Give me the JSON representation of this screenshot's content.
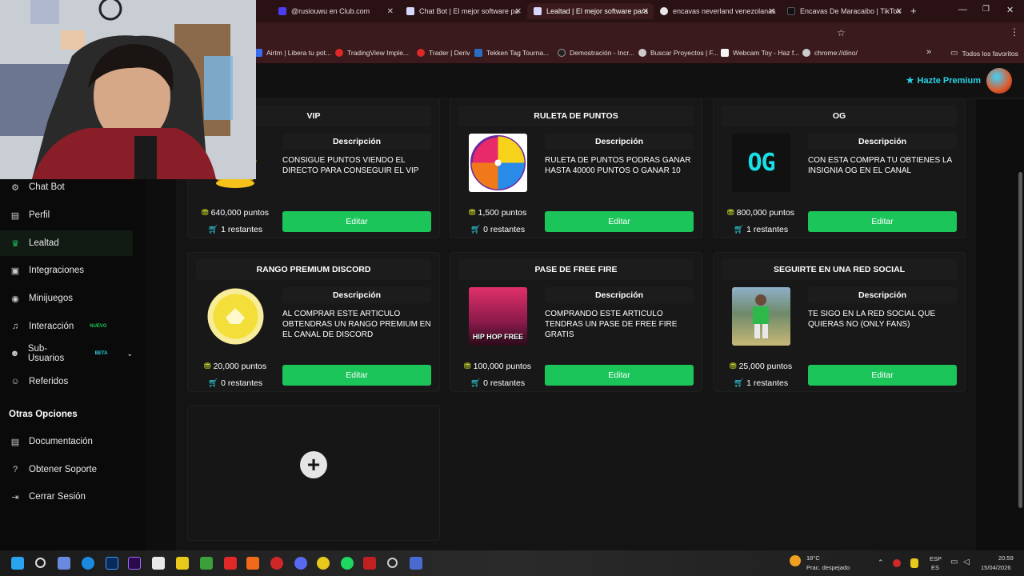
{
  "browser": {
    "tabs": [
      {
        "label": "@rusiouwu en Club.com",
        "color": "#4b3df0"
      },
      {
        "label": "Chat Bot | El mejor software pa",
        "color": "#d8d8ff"
      },
      {
        "label": "Lealtad | El mejor software para",
        "color": "#d8d8ff",
        "active": true
      },
      {
        "label": "encavas neverland venezolanas",
        "color": "#e8e8e8"
      },
      {
        "label": "Encavas De Maracaibo | TikTok",
        "color": "#111111"
      }
    ],
    "new_tab": "+",
    "bookmarks": [
      "Airtm | Libera tu pot...",
      "TradingView Imple...",
      "Trader | Deriv",
      "Tekken Tag Tourna...",
      "Demostración - Incr...",
      "Buscar Proyectos | F...",
      "Webcam Toy - Haz f...",
      "chrome://dino/"
    ],
    "bookmarks_more": "»",
    "all_bookmarks": "Todos los favoritos"
  },
  "header": {
    "premium_label": "Hazte Premium"
  },
  "sidebar": {
    "items": [
      {
        "label": "Chat Bot",
        "icon": "robot-icon"
      },
      {
        "label": "Perfil",
        "icon": "id-card-icon"
      },
      {
        "label": "Lealtad",
        "icon": "trophy-icon",
        "active": true
      },
      {
        "label": "Integraciones",
        "icon": "plug-icon"
      },
      {
        "label": "Minijuegos",
        "icon": "gamepad-icon"
      },
      {
        "label": "Interacción",
        "icon": "music-icon",
        "badge": "NUEVO",
        "badge_color": "#1cc55a"
      },
      {
        "label": "Sub-Usuarios",
        "icon": "users-icon",
        "badge": "BETA",
        "badge_color": "#29d3e6"
      },
      {
        "label": "Referidos",
        "icon": "user-group-icon"
      }
    ],
    "section_title": "Otras Opciones",
    "other": [
      {
        "label": "Documentación",
        "icon": "document-icon"
      },
      {
        "label": "Obtener Soporte",
        "icon": "help-icon"
      },
      {
        "label": "Cerrar Sesión",
        "icon": "logout-icon"
      }
    ]
  },
  "rewards": [
    {
      "title": "VIP",
      "desc_header": "Descripción",
      "description": "CONSIGUE PUNTOS VIENDO EL DIRECTO PARA CONSEGUIR EL VIP",
      "points": "640,000 puntos",
      "remaining": "1 restantes",
      "button": "Editar",
      "image": "crown-image"
    },
    {
      "title": "RULETA DE PUNTOS",
      "desc_header": "Descripción",
      "description": "RULETA DE PUNTOS PODRAS GANAR HASTA 40000 PUNTOS O GANAR 10",
      "points": "1,500 puntos",
      "remaining": "0 restantes",
      "button": "Editar",
      "image": "wheel-image"
    },
    {
      "title": "OG",
      "desc_header": "Descripción",
      "description": "CON ESTA COMPRA TU OBTIENES LA INSIGNIA OG EN EL CANAL",
      "points": "800,000 puntos",
      "remaining": "1 restantes",
      "button": "Editar",
      "image": "og-image",
      "image_text": "OG"
    },
    {
      "title": "RANGO PREMIUM DISCORD",
      "desc_header": "Descripción",
      "description": "AL COMPRAR ESTE ARTICULO OBTENDRAS UN RANGO PREMIUM EN EL CANAL DE DISCORD",
      "points": "20,000 puntos",
      "remaining": "0 restantes",
      "button": "Editar",
      "image": "discord-badge-image"
    },
    {
      "title": "PASE DE FREE FIRE",
      "desc_header": "Descripción",
      "description": "COMPRANDO ESTE ARTICULO TENDRAS UN PASE DE FREE FIRE GRATIS",
      "points": "100,000 puntos",
      "remaining": "0 restantes",
      "button": "Editar",
      "image": "freefire-image",
      "image_text": "HIP HOP FREE"
    },
    {
      "title": "SEGUIRTE EN UNA RED SOCIAL",
      "desc_header": "Descripción",
      "description": "TE SIGO EN LA RED SOCIAL QUE QUIERAS NO (ONLY FANS)",
      "points": "25,000 puntos",
      "remaining": "1 restantes",
      "button": "Editar",
      "image": "football-player-image"
    }
  ],
  "add_reward": "+",
  "taskbar": {
    "weather_temp": "18°C",
    "weather_desc": "Prac. despejado",
    "lang": "ESP",
    "region": "ES",
    "time": "20:59",
    "date": "15/04/2026"
  }
}
